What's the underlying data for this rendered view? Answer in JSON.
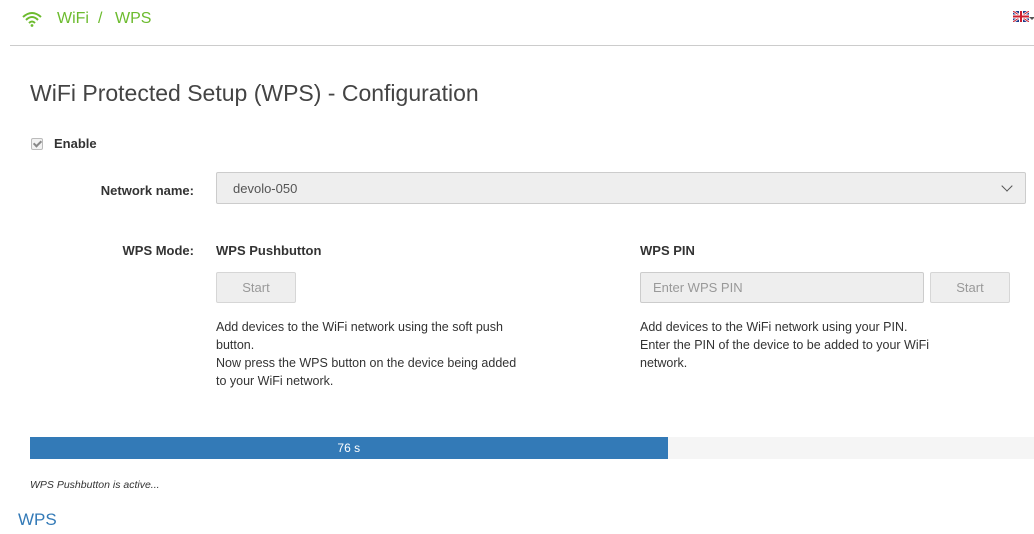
{
  "header": {
    "icon": "wifi-icon",
    "breadcrumb": [
      "WiFi",
      "/",
      "WPS"
    ],
    "language_icon": "uk-flag-icon",
    "accent_color": "#6cbb2e"
  },
  "page": {
    "title": "WiFi Protected Setup (WPS) - Configuration",
    "enable_label": "Enable",
    "enable_checked": true
  },
  "network": {
    "label": "Network name:",
    "value": "devolo-050"
  },
  "wps": {
    "mode_label": "WPS Mode:",
    "pushbutton": {
      "heading": "WPS Pushbutton",
      "start_label": "Start",
      "description": [
        "Add devices to the WiFi network using the soft push",
        "button.",
        "Now press the WPS button on the device being added",
        "to your WiFi network."
      ]
    },
    "pin": {
      "heading": "WPS PIN",
      "placeholder": "Enter WPS PIN",
      "start_label": "Start",
      "description": [
        "Add devices to the WiFi network using your PIN.",
        "Enter the PIN of the device to be added to your WiFi",
        "network."
      ]
    }
  },
  "progress": {
    "label": "76 s",
    "fraction": 0.635,
    "color": "#337ab7"
  },
  "status_text": "WPS Pushbutton is active...",
  "footer_text": "WPS"
}
